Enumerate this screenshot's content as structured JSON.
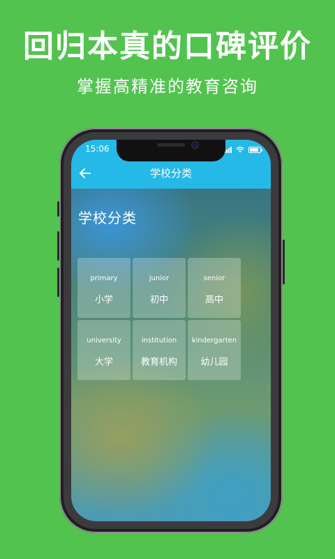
{
  "promo": {
    "headline": "回归本真的口碑评价",
    "subline": "掌握高精准的教育咨询"
  },
  "status_bar": {
    "time": "15:06",
    "icons": [
      "signal-icon",
      "wifi-icon",
      "battery-icon"
    ]
  },
  "nav": {
    "back_icon": "arrow-left-icon",
    "title": "学校分类"
  },
  "page": {
    "title": "学校分类"
  },
  "categories": [
    {
      "en": "primary",
      "zh": "小学"
    },
    {
      "en": "junior",
      "zh": "初中"
    },
    {
      "en": "senior",
      "zh": "高中"
    },
    {
      "en": "university",
      "zh": "大学"
    },
    {
      "en": "institution",
      "zh": "教育机构"
    },
    {
      "en": "kindergarten",
      "zh": "幼儿园"
    }
  ],
  "colors": {
    "background": "#52c34f",
    "navbar": "#25b9e8",
    "text": "#ffffff"
  }
}
